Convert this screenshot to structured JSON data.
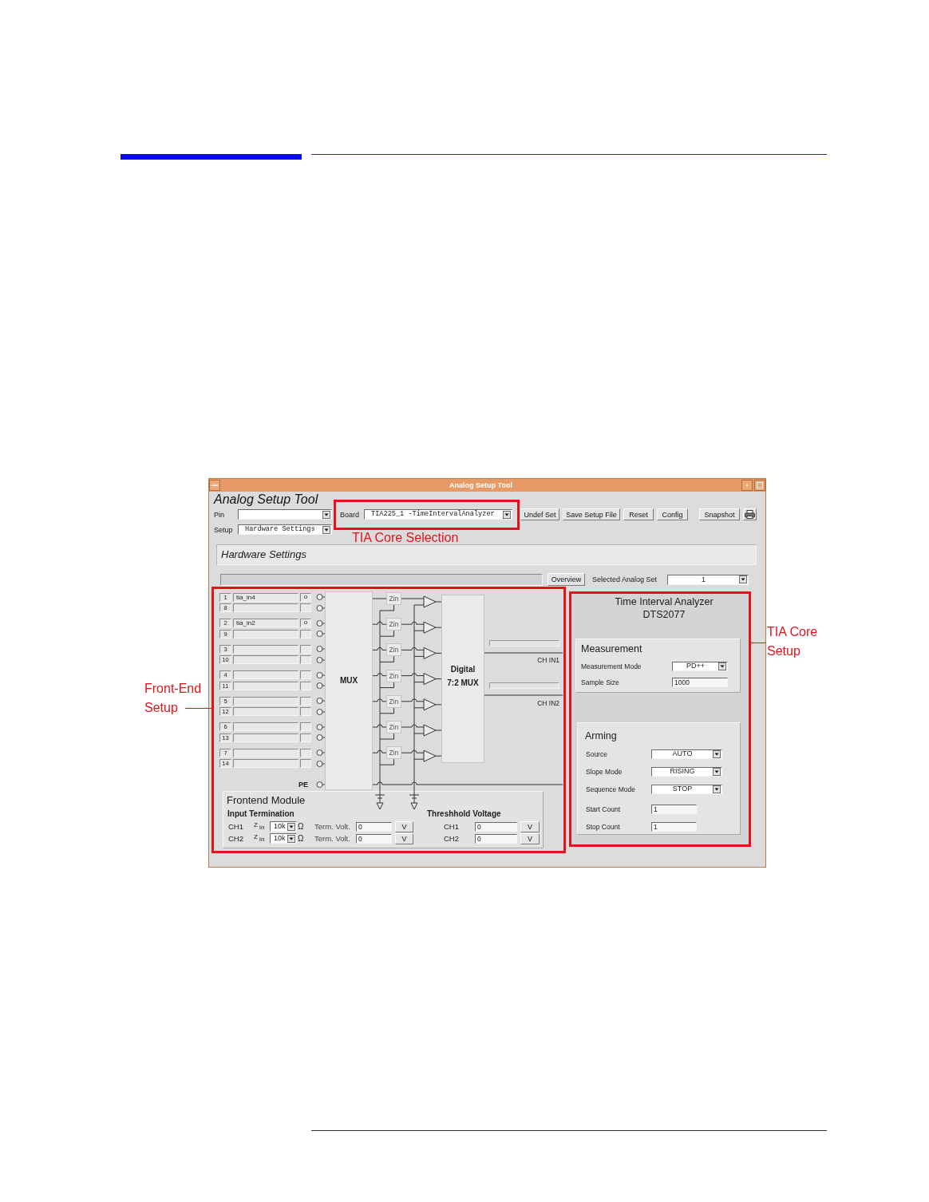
{
  "window": {
    "title": "Analog Setup Tool"
  },
  "toolbar": {
    "heading": "Analog Setup Tool",
    "pin": {
      "label": "Pin"
    },
    "board": {
      "label": "Board",
      "value": "TIA225_1 -TimeIntervalAnalyzer"
    },
    "buttons": [
      "Undef Set",
      "Save Setup File",
      "Reset",
      "Config",
      "Snapshot"
    ],
    "setup": {
      "label": "Setup",
      "value": "Hardware Settings"
    }
  },
  "section": {
    "title": "Hardware Settings",
    "overview_button": "Overview",
    "analog_set": {
      "label": "Selected Analog Set",
      "value": "1"
    }
  },
  "front_end": {
    "pin_groups": [
      [
        {
          "number": "1",
          "signal": "tia_in4",
          "flag": "o"
        },
        {
          "number": "8"
        }
      ],
      [
        {
          "number": "2",
          "signal": "tia_in2",
          "flag": "o"
        },
        {
          "number": "9"
        }
      ],
      [
        {
          "number": "3"
        },
        {
          "number": "10"
        }
      ],
      [
        {
          "number": "4"
        },
        {
          "number": "11"
        }
      ],
      [
        {
          "number": "5"
        },
        {
          "number": "12"
        }
      ],
      [
        {
          "number": "6"
        },
        {
          "number": "13"
        }
      ],
      [
        {
          "number": "7"
        },
        {
          "number": "14"
        }
      ]
    ],
    "pe_label": "PE",
    "mux_label": "MUX",
    "zin_blocks": [
      "Zin",
      "Zin",
      "Zin",
      "Zin",
      "Zin",
      "Zin",
      "Zin"
    ],
    "digital_mux_label": "Digital 7:2 MUX",
    "channel_outputs": [
      "CH IN1",
      "CH IN2"
    ]
  },
  "frontend_module": {
    "title": "Frontend Module",
    "input_termination": {
      "title": "Input Termination",
      "rows": [
        {
          "channel": "CH1",
          "z_label": "Z $_{in}$",
          "impedance": "10k",
          "unit": "Ω",
          "term_label": "Term. Volt.",
          "term_value": "0",
          "button": "V"
        },
        {
          "channel": "CH2",
          "z_label": "Z $_{in}$",
          "impedance": "10k",
          "unit": "Ω",
          "term_label": "Term. Volt.",
          "term_value": "0",
          "button": "V"
        }
      ]
    },
    "threshold_voltage": {
      "title": "Threshhold Voltage",
      "rows": [
        {
          "channel": "CH1",
          "value": "0",
          "button": "V"
        },
        {
          "channel": "CH2",
          "value": "0",
          "button": "V"
        }
      ]
    }
  },
  "tia_core": {
    "title": "Time Interval Analyzer",
    "model": "DTS2077",
    "measurement": {
      "title": "Measurement",
      "rows": [
        {
          "kind": "dropdown",
          "label": "Measurement Mode",
          "value": "PD++"
        },
        {
          "kind": "field",
          "label": "Sample Size",
          "value": "1000"
        }
      ]
    },
    "arming": {
      "title": "Arming",
      "rows": [
        {
          "kind": "dropdown",
          "label": "Source",
          "value": "AUTO"
        },
        {
          "kind": "dropdown",
          "label": "Slope Mode",
          "value": "RISING"
        },
        {
          "kind": "dropdown",
          "label": "Sequence Mode",
          "value": "STOP"
        },
        {
          "kind": "field",
          "label": "Start Count",
          "value": "1"
        },
        {
          "kind": "field",
          "label": "Stop Count",
          "value": "1"
        }
      ]
    }
  },
  "callouts": [
    {
      "kind": "selection",
      "lines": [
        "TIA Core Selection"
      ]
    },
    {
      "kind": "front_end",
      "lines": [
        "Front-End",
        "Setup"
      ]
    },
    {
      "kind": "core",
      "lines": [
        "TIA Core",
        "Setup"
      ]
    }
  ]
}
